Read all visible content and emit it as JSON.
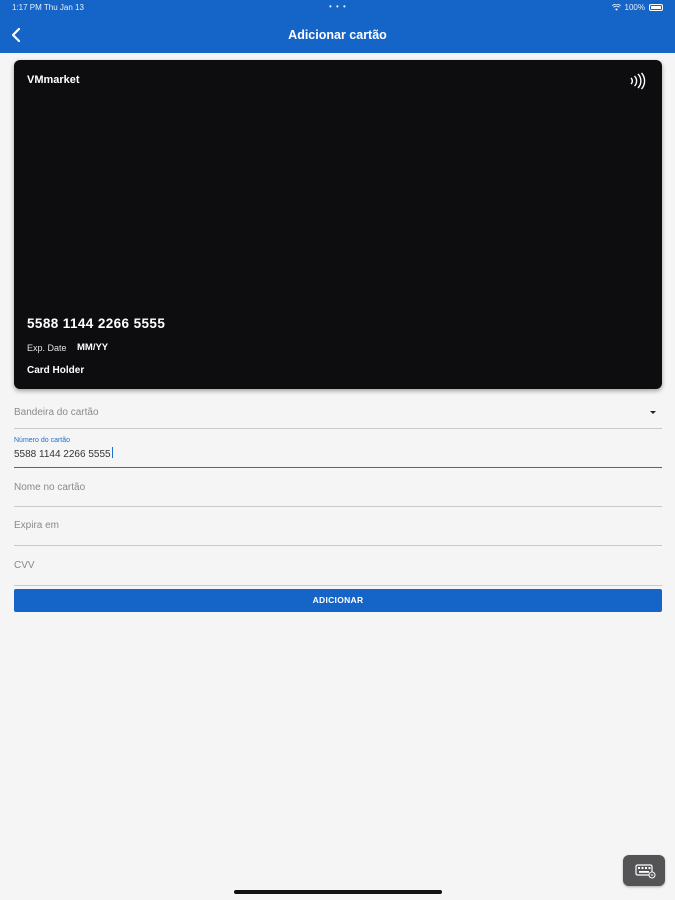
{
  "status_bar": {
    "time_date": "1:17 PM   Thu Jan 13",
    "center_dots": "• • •",
    "battery_text": "100%"
  },
  "header": {
    "title": "Adicionar cartão",
    "back_icon": "chevron-left-icon"
  },
  "card_preview": {
    "brand": "VMmarket",
    "number": "5588 1144 2266 5555",
    "exp_label": "Exp. Date",
    "exp_value": "MM/YY",
    "holder": "Card Holder",
    "contactless_icon": "contactless-icon"
  },
  "form": {
    "flag_placeholder": "Bandeira do cartão",
    "number_label": "Número do cartão",
    "number_value": "5588 1144 2266 5555",
    "name_placeholder": "Nome no cartão",
    "expiry_placeholder": "Expira em",
    "cvv_placeholder": "CVV",
    "submit_label": "ADICIONAR"
  },
  "colors": {
    "primary": "#1565c8",
    "card_background": "#0d0d10",
    "page_background": "#f5f5f5"
  }
}
